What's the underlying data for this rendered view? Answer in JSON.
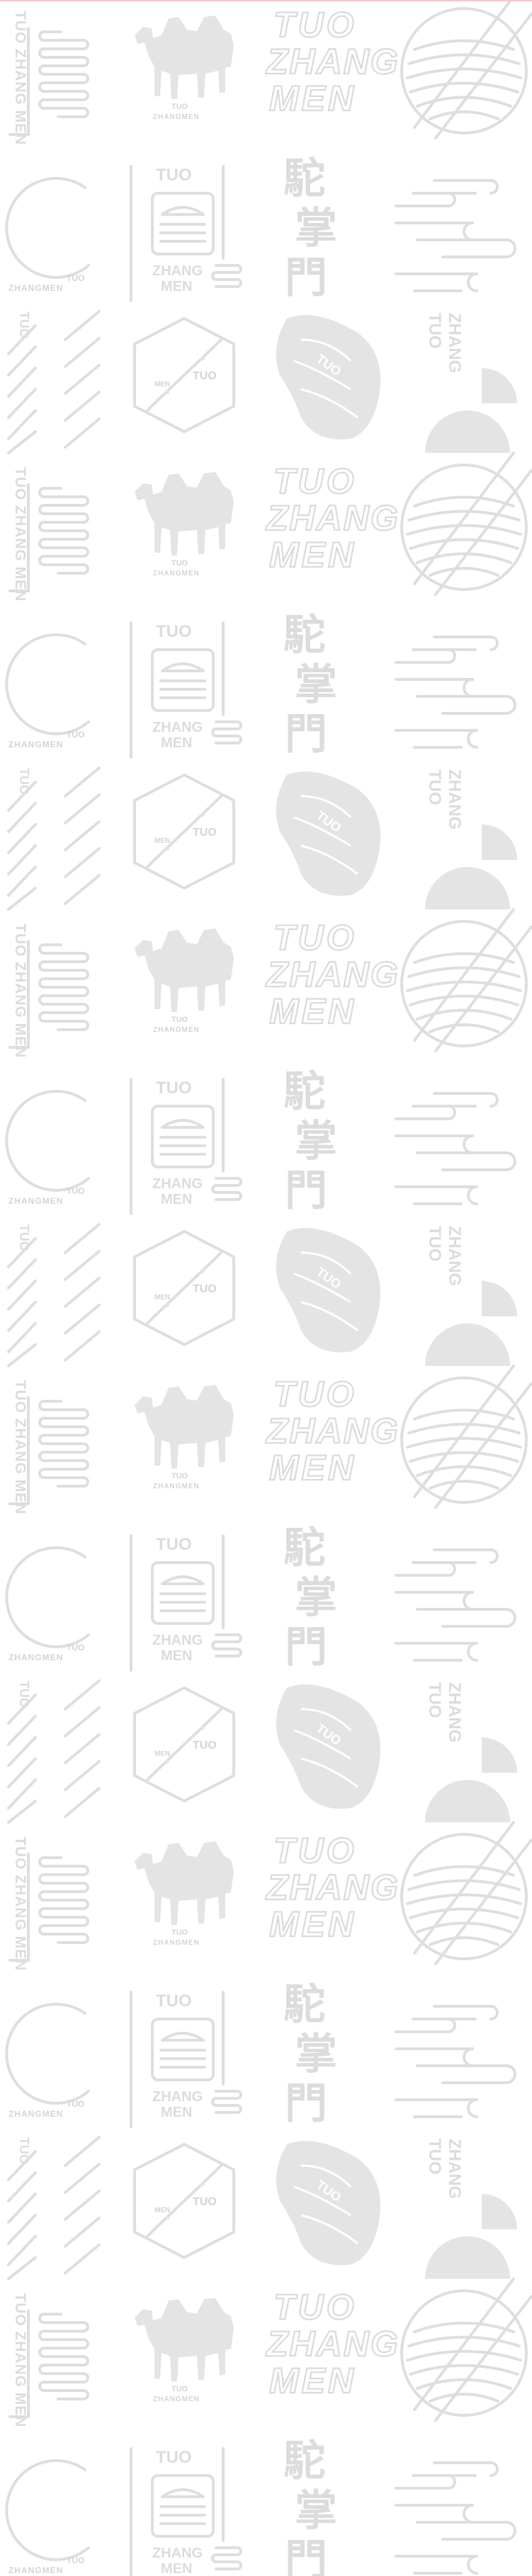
{
  "brand": {
    "word_tuo": "TUO",
    "word_zhang": "ZHANG",
    "word_men": "MEN",
    "full_name": "TUO ZHANG MEN",
    "caption": "ZHANGMEN",
    "chinese_1": "駝",
    "chinese_2": "掌",
    "chinese_3": "門"
  },
  "pattern": {
    "background_color": "#ffffff",
    "mark_color": "#dedede",
    "top_line_color": "#f3c9c9",
    "tile_icons": [
      "vertical-text-line-logo",
      "camel-logo",
      "italic-outline-wordmark",
      "crossed-noodle-bowl-logo",
      "ring-logo",
      "steamed-bun-badge-logo",
      "chinese-calligraphy-logo",
      "rolling-lines-logo",
      "stripe-column-logo",
      "hexagon-rolling-pin-logo",
      "meat-cut-logo",
      "vertical-wordmark-dome-logo"
    ]
  }
}
